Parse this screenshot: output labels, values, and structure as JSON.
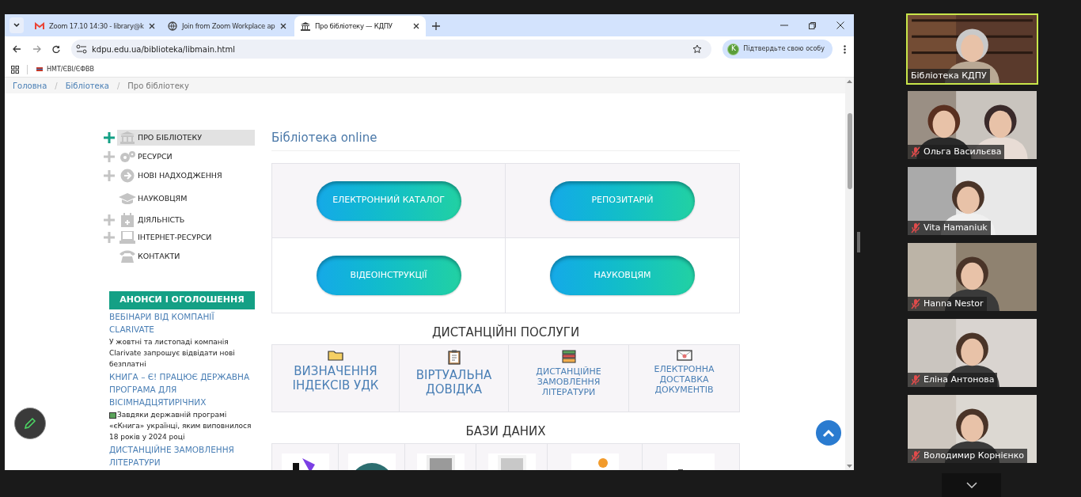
{
  "browser": {
    "tabs": [
      {
        "title": "Zoom 17.10 14:30 - library@k",
        "selected": false,
        "kind": "mail"
      },
      {
        "title": "Join from Zoom Workplace ap",
        "selected": false,
        "kind": "globe"
      },
      {
        "title": "Про бібліотеку — КДПУ",
        "selected": true,
        "kind": "site"
      }
    ],
    "url": "kdpu.edu.ua/biblioteka/libmain.html",
    "profile_button": "Підтвердьте свою особу",
    "profile_initial": "K",
    "bookmarks": [
      "НМТ/ЄВІ/ЄФВВ"
    ]
  },
  "page": {
    "breadcrumb_separator": "/",
    "breadcrumb": [
      {
        "label": "Головна",
        "link": true
      },
      {
        "label": "Бібліотека",
        "link": true
      },
      {
        "label": "Про бібліотеку",
        "link": false
      }
    ],
    "nav": [
      {
        "label": "ПРО БІБЛІОТЕКУ",
        "expandable": true,
        "selected": true
      },
      {
        "label": "РЕСУРСИ",
        "expandable": true,
        "selected": false
      },
      {
        "label": "НОВІ НАДХОДЖЕННЯ",
        "expandable": true,
        "selected": false
      },
      {
        "label": "НАУКОВЦЯМ",
        "expandable": false,
        "selected": false
      },
      {
        "label": "ДІЯЛЬНІСТЬ",
        "expandable": true,
        "selected": false
      },
      {
        "label": "ІНТЕРНЕТ-РЕСУРСИ",
        "expandable": true,
        "selected": false
      },
      {
        "label": "КОНТАКТИ",
        "expandable": false,
        "selected": false
      }
    ],
    "announcements": {
      "title": "АНОНСИ І ОГОЛОШЕННЯ",
      "items": [
        {
          "title": "ВЕБІНАРИ ВІД КОМПАНІЇ CLARIVATE",
          "text": "У жовтні та листопаді компанія Clarivate запрошує відвідати нові безплатні"
        },
        {
          "title": "КНИГА – Є! ПРАЦЮЄ ДЕРЖАВНА ПРОГРАМА ДЛЯ ВІСІМНАДЦЯТИРІЧНИХ",
          "text": "Завдяки державній програмі «єКнига» українці, яким виповнилося 18 років у 2024 році"
        },
        {
          "title": "ДИСТАНЦІЙНЕ ЗАМОВЛЕННЯ ЛІТЕРАТУРИ"
        }
      ]
    },
    "online_title": "Бібліотека online",
    "online_buttons": [
      "ЕЛЕКТРОННИЙ КАТАЛОГ",
      "РЕПОЗИТАРІЙ",
      "ВІДЕОІНСТРУКЦІЇ",
      "НАУКОВЦЯМ"
    ],
    "services_title": "ДИСТАНЦІЙНІ ПОСЛУГИ",
    "services": [
      {
        "label": "ВИЗНАЧЕННЯ ІНДЕКСІВ УДК",
        "kind": "folder"
      },
      {
        "label": "ВІРТУАЛЬНА ДОВІДКА",
        "kind": "clipboard"
      },
      {
        "label": "ДИСТАНЦІЙНЕ ЗАМОВЛЕННЯ ЛІТЕРАТУРИ",
        "kind": "books"
      },
      {
        "label": "ЕЛЕКТРОННА ДОСТАВКА ДОКУМЕНТІВ",
        "kind": "envelope"
      }
    ],
    "databases_title": "БАЗИ ДАНИХ"
  },
  "participants": [
    {
      "name": "Бібліотека КДПУ",
      "muted": false,
      "speaking": true
    },
    {
      "name": "Ольга Васильєва",
      "muted": true,
      "speaking": false
    },
    {
      "name": "Vita Hamaniuk",
      "muted": true,
      "speaking": false
    },
    {
      "name": "Hanna Nestor",
      "muted": true,
      "speaking": false
    },
    {
      "name": "Еліна Антонова",
      "muted": true,
      "speaking": false
    },
    {
      "name": "Володимир Корнієнко",
      "muted": true,
      "speaking": false
    }
  ]
}
